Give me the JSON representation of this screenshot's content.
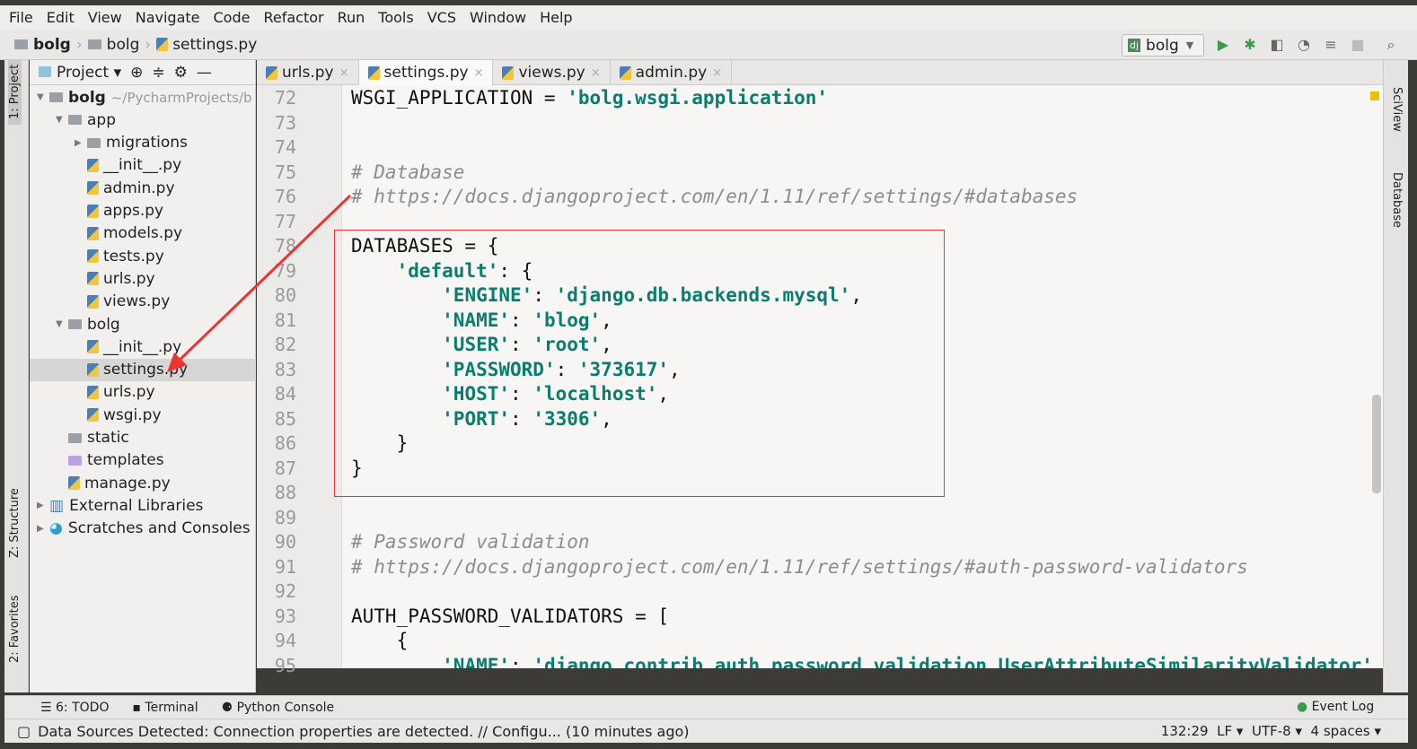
{
  "menu": [
    "File",
    "Edit",
    "View",
    "Navigate",
    "Code",
    "Refactor",
    "Run",
    "Tools",
    "VCS",
    "Window",
    "Help"
  ],
  "breadcrumb": [
    "bolg",
    "bolg",
    "settings.py"
  ],
  "run_config": "bolg",
  "toolbar_icons": [
    "run-icon",
    "debug-icon",
    "coverage-icon",
    "profile-icon",
    "concurrency-icon",
    "stop-icon",
    "search-icon"
  ],
  "left_strip": [
    "1: Project",
    "Z: Structure",
    "2: Favorites"
  ],
  "right_strip": [
    "SciView",
    "Database"
  ],
  "project": {
    "title": "Project",
    "root_path": "~/PycharmProjects/b",
    "tree": [
      {
        "label": "bolg",
        "type": "folder",
        "depth": 0,
        "open": true,
        "bold": true
      },
      {
        "label": "app",
        "type": "folder",
        "depth": 1,
        "open": true
      },
      {
        "label": "migrations",
        "type": "folder",
        "depth": 2,
        "open": false
      },
      {
        "label": "__init__.py",
        "type": "py",
        "depth": 2
      },
      {
        "label": "admin.py",
        "type": "py",
        "depth": 2
      },
      {
        "label": "apps.py",
        "type": "py",
        "depth": 2
      },
      {
        "label": "models.py",
        "type": "py",
        "depth": 2
      },
      {
        "label": "tests.py",
        "type": "py",
        "depth": 2
      },
      {
        "label": "urls.py",
        "type": "py",
        "depth": 2
      },
      {
        "label": "views.py",
        "type": "py",
        "depth": 2
      },
      {
        "label": "bolg",
        "type": "folder",
        "depth": 1,
        "open": true
      },
      {
        "label": "__init__.py",
        "type": "py",
        "depth": 2
      },
      {
        "label": "settings.py",
        "type": "py",
        "depth": 2,
        "selected": true
      },
      {
        "label": "urls.py",
        "type": "py",
        "depth": 2
      },
      {
        "label": "wsgi.py",
        "type": "py",
        "depth": 2
      },
      {
        "label": "static",
        "type": "folder",
        "depth": 1
      },
      {
        "label": "templates",
        "type": "folder",
        "depth": 1
      },
      {
        "label": "manage.py",
        "type": "py",
        "depth": 1
      },
      {
        "label": "External Libraries",
        "type": "lib",
        "depth": 0,
        "open": false
      },
      {
        "label": "Scratches and Consoles",
        "type": "scratch",
        "depth": 0,
        "open": false
      }
    ]
  },
  "tabs": [
    {
      "label": "urls.py"
    },
    {
      "label": "settings.py",
      "active": true
    },
    {
      "label": "views.py"
    },
    {
      "label": "admin.py"
    }
  ],
  "code": [
    {
      "n": "72",
      "seg": [
        [
          "WSGI_APPLICATION = ",
          ""
        ],
        [
          "'bolg.wsgi.application'",
          "s"
        ]
      ]
    },
    {
      "n": "73",
      "seg": []
    },
    {
      "n": "74",
      "seg": []
    },
    {
      "n": "75",
      "seg": [
        [
          "# Database",
          "c"
        ]
      ]
    },
    {
      "n": "76",
      "seg": [
        [
          "# https://docs.djangoproject.com/en/1.11/ref/settings/#databases",
          "c"
        ]
      ]
    },
    {
      "n": "77",
      "seg": []
    },
    {
      "n": "78",
      "seg": [
        [
          "DATABASES = {",
          ""
        ]
      ]
    },
    {
      "n": "79",
      "seg": [
        [
          "    ",
          ""
        ],
        [
          "'default'",
          "s"
        ],
        [
          ": {",
          ""
        ]
      ]
    },
    {
      "n": "80",
      "seg": [
        [
          "        ",
          ""
        ],
        [
          "'ENGINE'",
          "s"
        ],
        [
          ": ",
          ""
        ],
        [
          "'django.db.backends.mysql'",
          "s"
        ],
        [
          ",",
          ""
        ]
      ]
    },
    {
      "n": "81",
      "seg": [
        [
          "        ",
          ""
        ],
        [
          "'NAME'",
          "s"
        ],
        [
          ": ",
          ""
        ],
        [
          "'blog'",
          "s"
        ],
        [
          ",",
          ""
        ]
      ]
    },
    {
      "n": "82",
      "seg": [
        [
          "        ",
          ""
        ],
        [
          "'USER'",
          "s"
        ],
        [
          ": ",
          ""
        ],
        [
          "'root'",
          "s"
        ],
        [
          ",",
          ""
        ]
      ]
    },
    {
      "n": "83",
      "seg": [
        [
          "        ",
          ""
        ],
        [
          "'PASSWORD'",
          "s"
        ],
        [
          ": ",
          ""
        ],
        [
          "'373617'",
          "s"
        ],
        [
          ",",
          ""
        ]
      ]
    },
    {
      "n": "84",
      "seg": [
        [
          "        ",
          ""
        ],
        [
          "'HOST'",
          "s"
        ],
        [
          ": ",
          ""
        ],
        [
          "'localhost'",
          "s"
        ],
        [
          ",",
          ""
        ]
      ]
    },
    {
      "n": "85",
      "seg": [
        [
          "        ",
          ""
        ],
        [
          "'PORT'",
          "s"
        ],
        [
          ": ",
          ""
        ],
        [
          "'3306'",
          "s"
        ],
        [
          ",",
          ""
        ]
      ]
    },
    {
      "n": "86",
      "seg": [
        [
          "    }",
          ""
        ]
      ]
    },
    {
      "n": "87",
      "seg": [
        [
          "}",
          ""
        ]
      ]
    },
    {
      "n": "88",
      "seg": []
    },
    {
      "n": "89",
      "seg": []
    },
    {
      "n": "90",
      "seg": [
        [
          "# Password validation",
          "c"
        ]
      ]
    },
    {
      "n": "91",
      "seg": [
        [
          "# https://docs.djangoproject.com/en/1.11/ref/settings/#auth-password-validators",
          "c"
        ]
      ]
    },
    {
      "n": "92",
      "seg": []
    },
    {
      "n": "93",
      "seg": [
        [
          "AUTH_PASSWORD_VALIDATORS = [",
          ""
        ]
      ]
    },
    {
      "n": "94",
      "seg": [
        [
          "    {",
          ""
        ]
      ]
    },
    {
      "n": "95",
      "seg": [
        [
          "        ",
          ""
        ],
        [
          "'NAME'",
          "s"
        ],
        [
          ": ",
          ""
        ],
        [
          "'django.contrib.auth.password_validation.UserAttributeSimilarityValidator'",
          "s"
        ]
      ]
    }
  ],
  "bottom_tools": [
    "6: TODO",
    "Terminal",
    "Python Console"
  ],
  "event_log": "Event Log",
  "status": {
    "message": "Data Sources Detected: Connection properties are detected. // Configu... (10 minutes ago)",
    "position": "132:29",
    "line_sep": "LF",
    "encoding": "UTF-8",
    "indent": "4 spaces"
  },
  "colors": {
    "string": "#0a7d6e",
    "comment": "#8c8c8c",
    "highlight_box": "#ee3333",
    "arrow": "#ee3333"
  }
}
